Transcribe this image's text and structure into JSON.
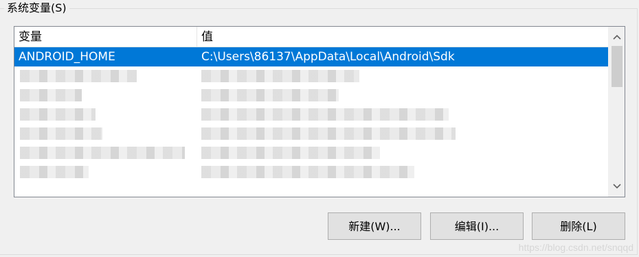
{
  "group": {
    "title": "系统变量(S)"
  },
  "listview": {
    "columns": [
      "变量",
      "值"
    ],
    "rows": [
      {
        "variable": "ANDROID_HOME",
        "value": "C:\\Users\\86137\\AppData\\Local\\Android\\Sdk",
        "selected": true,
        "blurred": false
      },
      {
        "variable": "",
        "value": "",
        "selected": false,
        "blurred": true
      },
      {
        "variable": "",
        "value": "",
        "selected": false,
        "blurred": true
      },
      {
        "variable": "",
        "value": "",
        "selected": false,
        "blurred": true
      },
      {
        "variable": "",
        "value": "",
        "selected": false,
        "blurred": true
      },
      {
        "variable": "",
        "value": "",
        "selected": false,
        "blurred": true
      },
      {
        "variable": "",
        "value": "",
        "selected": false,
        "blurred": true
      }
    ]
  },
  "scrollbar": {
    "up_icon": "chevron-up-icon",
    "down_icon": "chevron-down-icon"
  },
  "buttons": {
    "new_label": "新建(W)...",
    "edit_label": "编辑(I)...",
    "delete_label": "删除(L)"
  },
  "watermark": "https://blog.csdn.net/snqqd",
  "colors": {
    "selection": "#0078d7",
    "button_bg": "#e1e1e1",
    "window_bg": "#f0f0f0"
  }
}
